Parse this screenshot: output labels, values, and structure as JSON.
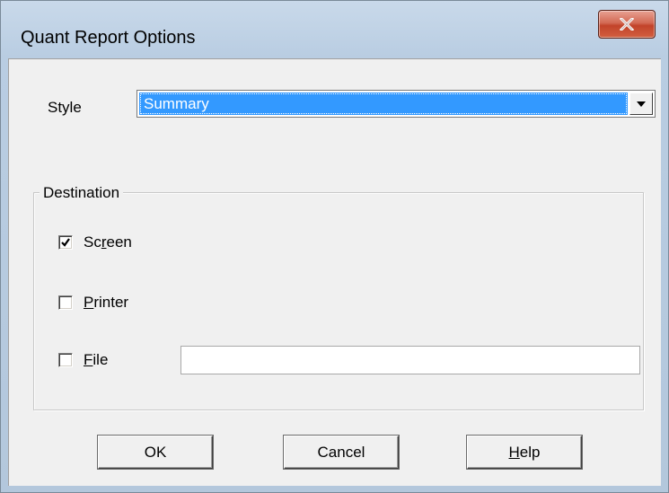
{
  "window": {
    "title": "Quant Report Options",
    "close_icon": "close-icon"
  },
  "style": {
    "label": "Style",
    "selected": "Summary",
    "dropdown_icon": "chevron-down-icon"
  },
  "destination": {
    "legend": "Destination",
    "options": [
      {
        "pre": "Sc",
        "underline": "r",
        "post": "een",
        "checked": true
      },
      {
        "pre": "",
        "underline": "P",
        "post": "rinter",
        "checked": false
      },
      {
        "pre": "",
        "underline": "F",
        "post": "ile",
        "checked": false
      }
    ],
    "file_path_value": ""
  },
  "buttons": {
    "ok": "OK",
    "cancel": "Cancel",
    "help_underline": "H",
    "help_rest": "elp"
  },
  "colors": {
    "selection": "#3399ff",
    "close_button": "#c2432a",
    "title_bar": "#b9cde2"
  }
}
